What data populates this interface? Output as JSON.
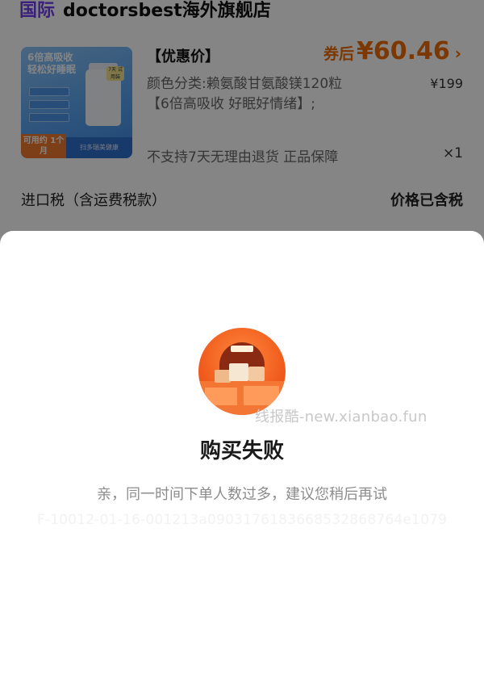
{
  "store": {
    "badge": "国际",
    "name": "doctorsbest海外旗舰店"
  },
  "product": {
    "thumbnail": {
      "headline": "6倍高吸收 轻松好睡眠",
      "corner_tag": "7天 试用装",
      "period_tag": "可用约 1个月",
      "bottom_bar": "扫多瑞美健康"
    },
    "price_label": "【优惠价】",
    "coupon_label": "券后",
    "coupon_price": "¥60.46",
    "coupon_chevron": "›",
    "spec": "颜色分类:赖氨酸甘氨酸镁120粒【6倍高吸收 好眠好情绪】;",
    "original_price": "¥199",
    "service": "不支持7天无理由退货  正品保障",
    "quantity": "×1"
  },
  "tax": {
    "label": "进口税（含运费税款）",
    "value": "价格已含税"
  },
  "modal": {
    "icon": "storefront-closed-icon",
    "watermark": "线报酷-new.xianbao.fun",
    "title": "购买失败",
    "message": "亲，同一时间下单人数过多，建议您稍后再试",
    "error_code": "F-10012-01-16-001213a0903176183668532868764e1079"
  },
  "colors": {
    "accent_orange": "#f06a00",
    "store_badge_purple": "#6f3cf0"
  }
}
